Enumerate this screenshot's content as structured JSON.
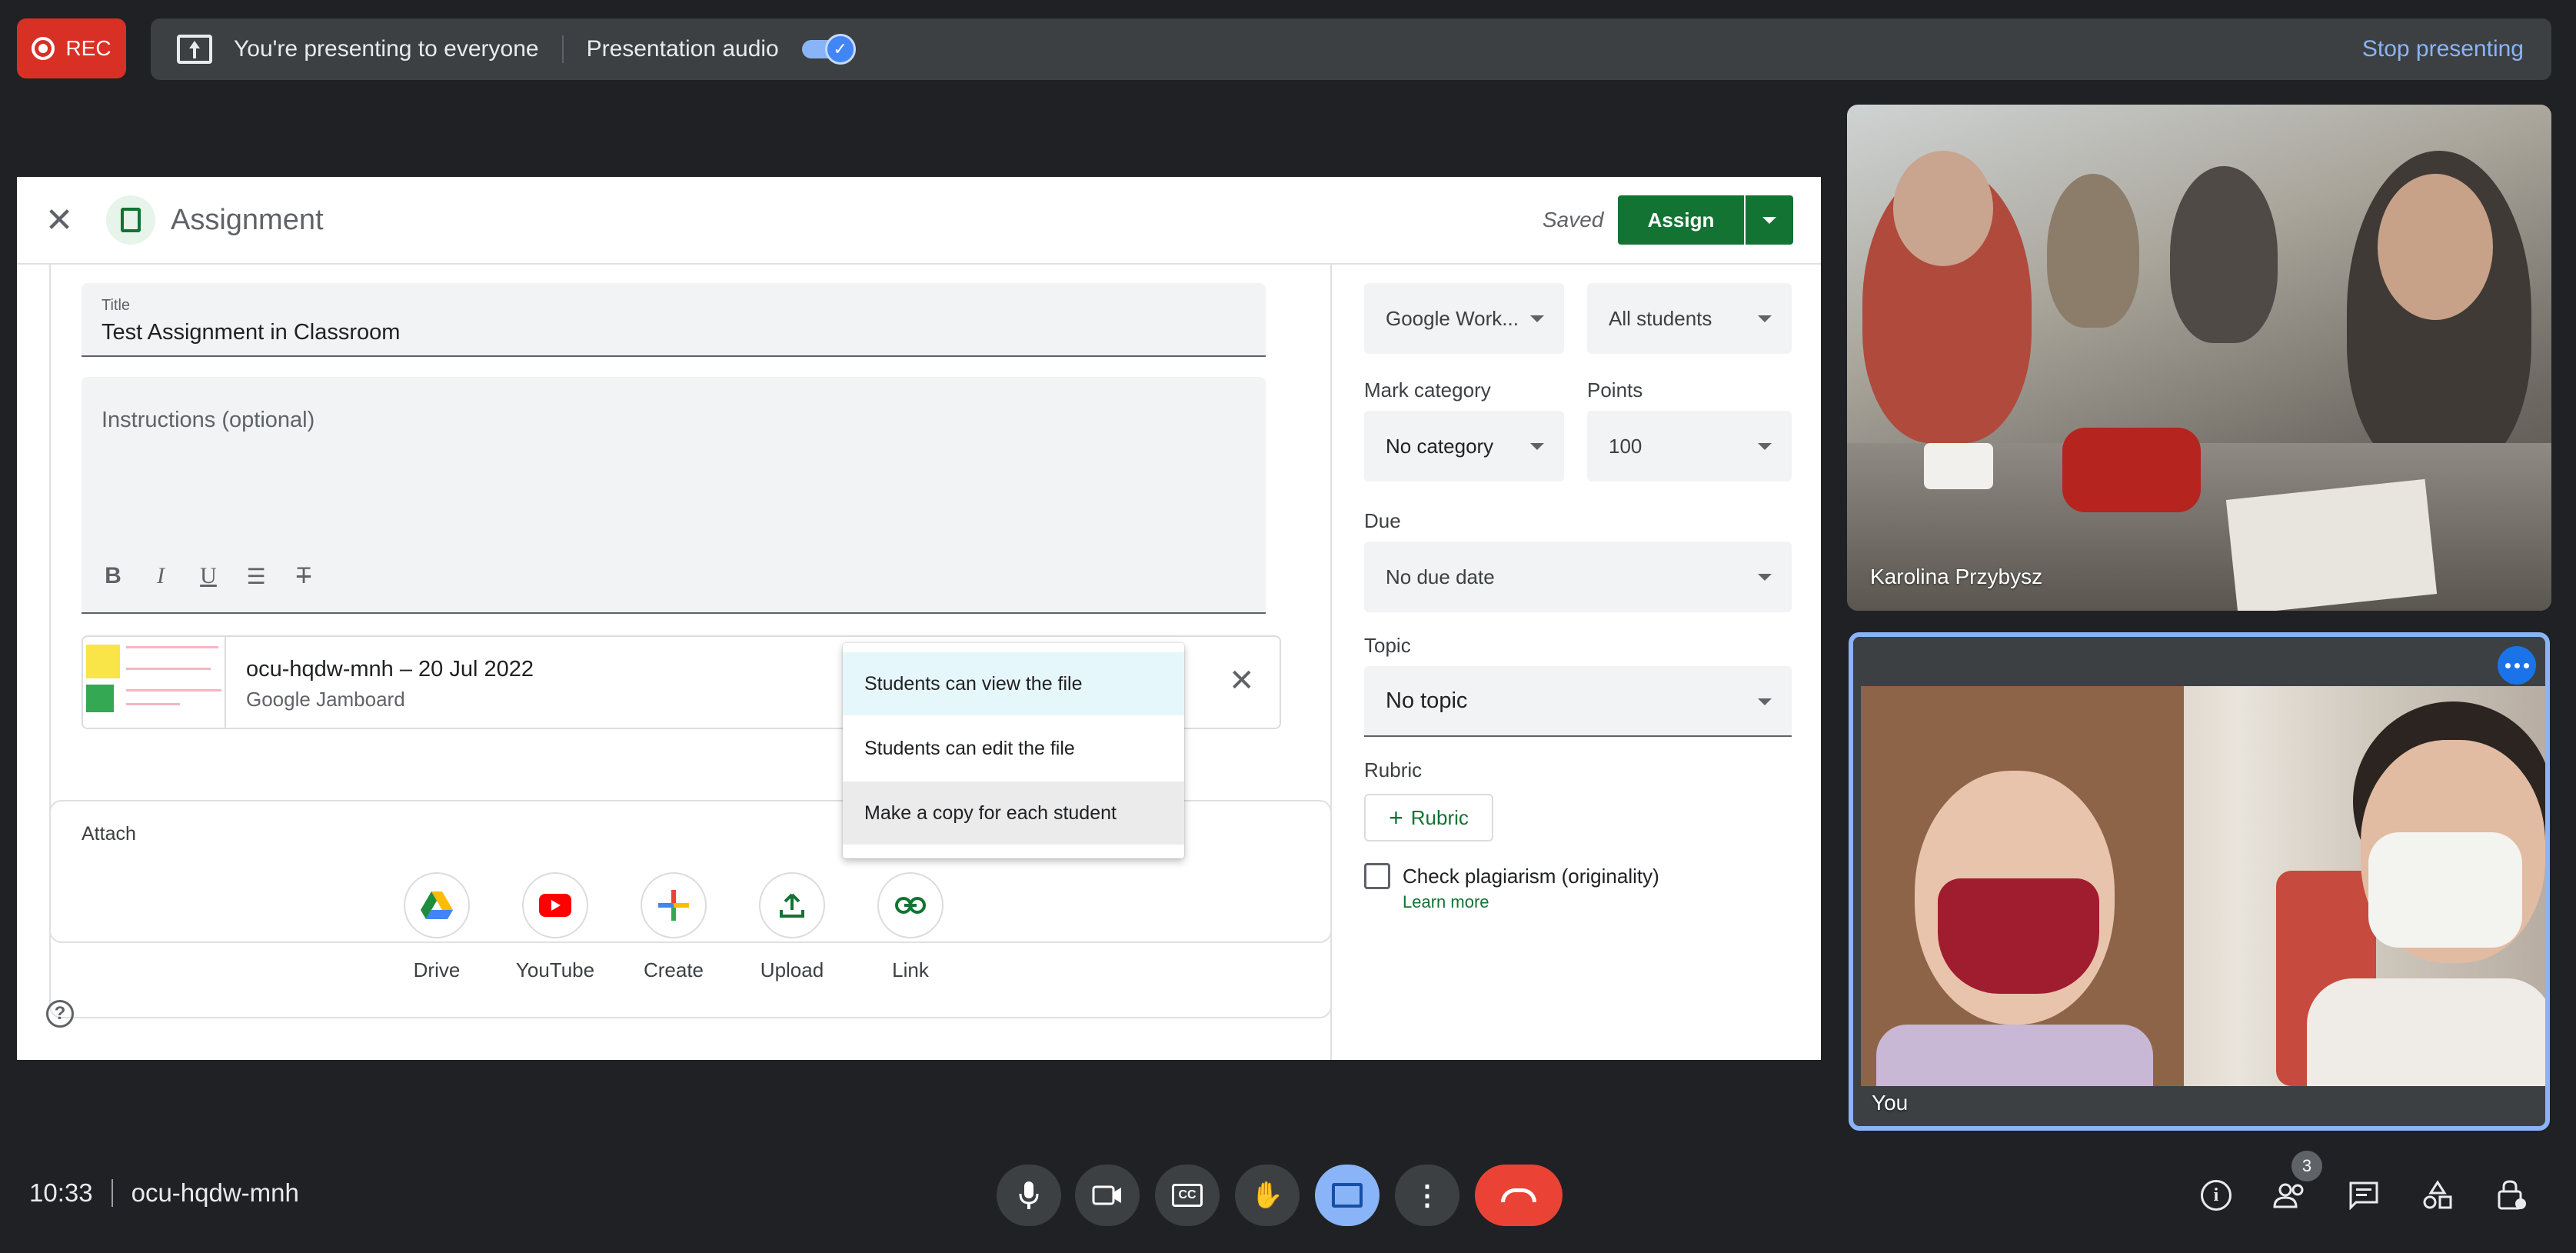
{
  "colors": {
    "rec": "#d93025",
    "accent_blue": "#8ab4f8",
    "classroom_green": "#137333",
    "end_call": "#ea4335"
  },
  "top_bar": {
    "rec_label": "REC",
    "presenting_text": "You're presenting to everyone",
    "audio_label": "Presentation audio",
    "audio_enabled": true,
    "stop_label": "Stop presenting"
  },
  "assignment": {
    "header_title": "Assignment",
    "saved_label": "Saved",
    "assign_label": "Assign",
    "title_field_label": "Title",
    "title_value": "Test Assignment in Classroom",
    "instructions_placeholder": "Instructions (optional)",
    "format_tools": [
      "B",
      "I",
      "U",
      "list",
      "clear-format"
    ],
    "attachment": {
      "name": "ocu-hqdw-mnh – 20 Jul 2022",
      "type": "Google Jamboard"
    },
    "share_menu": [
      "Students can view the file",
      "Students can edit the file",
      "Make a copy for each student"
    ],
    "attach_label": "Attach",
    "attach_options": [
      "Drive",
      "YouTube",
      "Create",
      "Upload",
      "Link"
    ],
    "side": {
      "class_value": "Google Work...",
      "students_value": "All students",
      "mark_category_label": "Mark category",
      "mark_category_value": "No category",
      "points_label": "Points",
      "points_value": "100",
      "due_label": "Due",
      "due_value": "No due date",
      "topic_label": "Topic",
      "topic_value": "No topic",
      "rubric_label": "Rubric",
      "rubric_button": "Rubric",
      "plagiarism_label": "Check plagiarism (originality)",
      "learn_more": "Learn more"
    }
  },
  "participants": [
    {
      "name": "Karolina Przybysz"
    },
    {
      "name": "You"
    }
  ],
  "bottom_bar": {
    "time": "10:33",
    "meeting_code": "ocu-hqdw-mnh",
    "people_count": "3"
  }
}
